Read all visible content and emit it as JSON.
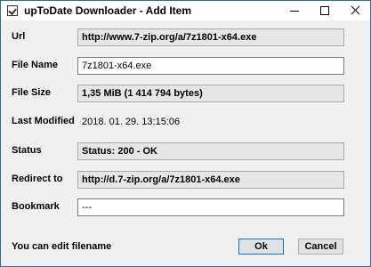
{
  "window": {
    "title": "upToDate Downloader - Add Item"
  },
  "fields": {
    "url": {
      "label": "Url",
      "value": "http://www.7-zip.org/a/7z1801-x64.exe"
    },
    "file_name": {
      "label": "File Name",
      "value": "7z1801-x64.exe"
    },
    "file_size": {
      "label": "File Size",
      "value": "1,35 MiB (1 414 794 bytes)"
    },
    "last_modified": {
      "label": "Last Modified",
      "value": "2018. 01. 29. 13:15:06"
    },
    "status": {
      "label": "Status",
      "value": "Status: 200 - OK"
    },
    "redirect": {
      "label": "Redirect to",
      "value": "http://d.7-zip.org/a/7z1801-x64.exe"
    },
    "bookmark": {
      "label": "Bookmark",
      "value": "---"
    }
  },
  "footer": {
    "hint": "You can edit filename",
    "ok_label": "Ok",
    "cancel_label": "Cancel"
  }
}
